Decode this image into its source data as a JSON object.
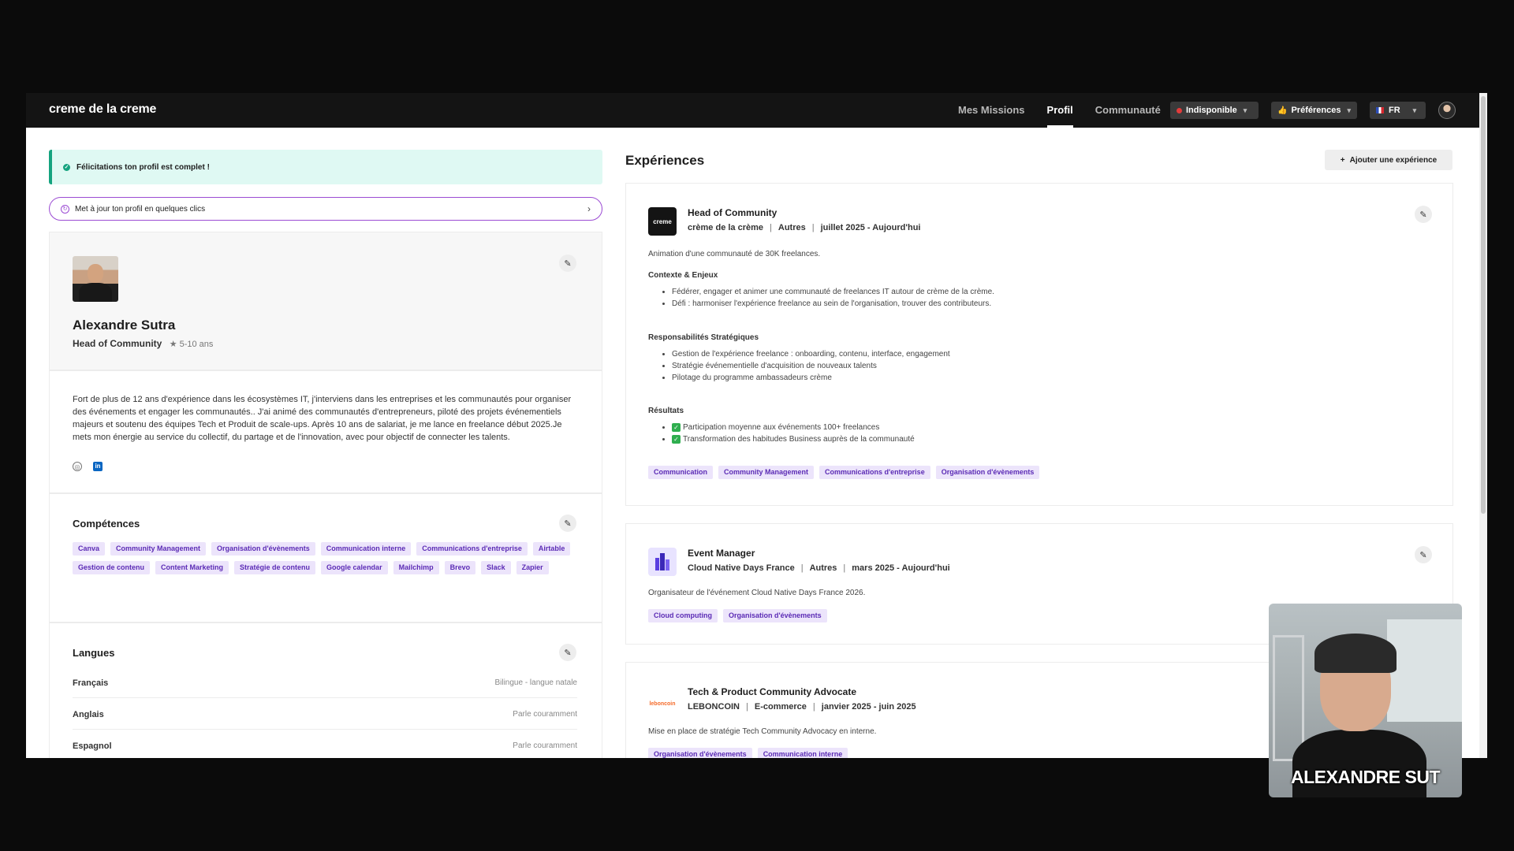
{
  "app": {
    "logo": "creme de la creme"
  },
  "nav": {
    "items": [
      {
        "label": "Mes Missions",
        "active": false
      },
      {
        "label": "Profil",
        "active": true
      },
      {
        "label": "Communauté",
        "active": false
      }
    ],
    "status_label": "Indisponible",
    "preferences_label": "Préférences",
    "language_label": "FR"
  },
  "banner": {
    "text": "Félicitations ton profil est complet !"
  },
  "update_prompt": {
    "text": "Met à jour ton profil en quelques clics"
  },
  "profile": {
    "name": "Alexandre Sutra",
    "role": "Head of Community",
    "experience": "5-10 ans",
    "bio": "Fort de plus de 12 ans d'expérience dans les écosystèmes IT, j'interviens dans les entreprises et les communautés pour organiser des événements et engager les communautés.. J'ai animé des communautés d'entrepreneurs, piloté des projets événementiels majeurs et soutenu des équipes Tech et Produit de scale-ups. Après 10 ans de salariat, je me lance en freelance début 2025.Je mets mon énergie au service du collectif, du partage et de l'innovation, avec pour objectif de connecter les talents."
  },
  "skills": {
    "title": "Compétences",
    "items": [
      "Canva",
      "Community Management",
      "Organisation d'évènements",
      "Communication interne",
      "Communications d'entreprise",
      "Airtable",
      "Gestion de contenu",
      "Content Marketing",
      "Stratégie de contenu",
      "Google calendar",
      "Mailchimp",
      "Brevo",
      "Slack",
      "Zapier"
    ]
  },
  "languages": {
    "title": "Langues",
    "items": [
      {
        "name": "Français",
        "level": "Bilingue - langue natale"
      },
      {
        "name": "Anglais",
        "level": "Parle couramment"
      },
      {
        "name": "Espagnol",
        "level": "Parle couramment"
      }
    ]
  },
  "experiences": {
    "title": "Expériences",
    "add_label": "Ajouter une expérience",
    "items": [
      {
        "title": "Head of Community",
        "company": "crème de la crème",
        "sector": "Autres",
        "period": "juillet 2025 - Aujourd'hui",
        "logo_text": "creme",
        "summary": "Animation d'une communauté de 30K freelances.",
        "context_title": "Contexte & Enjeux",
        "context": [
          "Fédérer, engager et animer une communauté de freelances IT autour de crème de la crème.",
          "Défi : harmoniser l'expérience freelance au sein de l'organisation, trouver des contributeurs."
        ],
        "resp_title": "Responsabilités Stratégiques",
        "resp": [
          "Gestion de l'expérience freelance : onboarding, contenu, interface, engagement",
          "Stratégie événementielle d'acquisition de nouveaux talents",
          "Pilotage du programme ambassadeurs crème"
        ],
        "results_title": "Résultats",
        "results": [
          "Participation moyenne aux événements 100+ freelances",
          "Transformation des habitudes Business auprès de la communauté"
        ],
        "tags": [
          "Communication",
          "Community Management",
          "Communications d'entreprise",
          "Organisation d'évènements"
        ]
      },
      {
        "title": "Event Manager",
        "company": "Cloud Native Days France",
        "sector": "Autres",
        "period": "mars 2025 - Aujourd'hui",
        "summary": "Organisateur de l'événement Cloud Native Days France 2026.",
        "tags": [
          "Cloud computing",
          "Organisation d'évènements"
        ]
      },
      {
        "title": "Tech & Product Community Advocate",
        "company": "LEBONCOIN",
        "sector": "E-commerce",
        "period": "janvier 2025 - juin 2025",
        "logo_text": "leboncoin",
        "summary": "Mise en place de stratégie Tech Community Advocacy en interne.",
        "tags": [
          "Organisation d'évènements",
          "Communication interne"
        ]
      }
    ]
  },
  "webcam": {
    "label": "ALEXANDRE SUT"
  },
  "colors": {
    "accent": "#9b4bd3",
    "success": "#14a37f",
    "tag_bg": "#ece4fb",
    "tag_fg": "#5b2bb5"
  }
}
